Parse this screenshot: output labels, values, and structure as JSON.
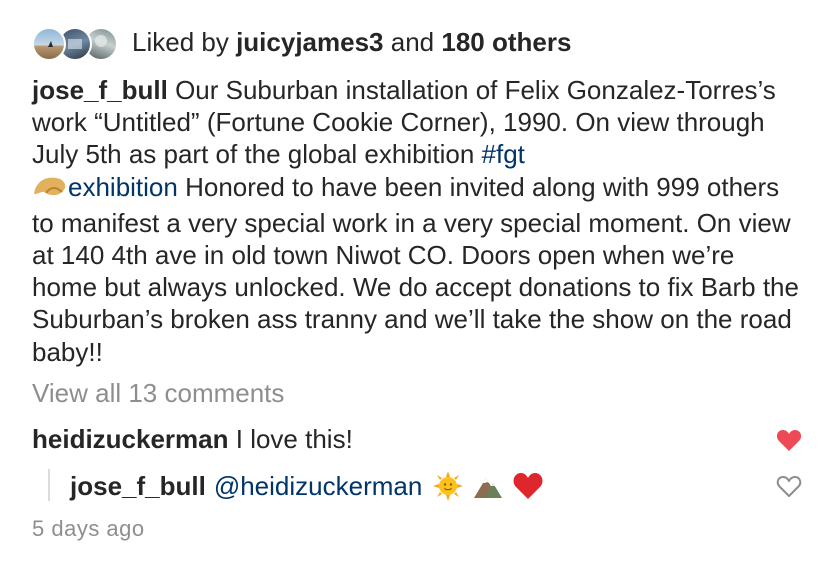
{
  "likes": {
    "prefix": "Liked by",
    "user": "juicyjames3",
    "connector": "and",
    "others": "180 others"
  },
  "post": {
    "username": "jose_f_bull",
    "caption_part1": "Our Suburban installation of Felix Gonzalez-Torres’s work “Untitled” (Fortune Cookie Corner), 1990. On view through July 5th as part of the global exhibition ",
    "hashtag": "#fgt",
    "cookie_icon": "fortune-cookie-emoji",
    "hashtag_cont": "exhibition",
    "caption_part2": " Honored to have been invited along with 999 others to manifest a very special work in a very special moment. On view at 140 4th ave in old town Niwot CO. Doors open when we’re home but always unlocked. We do accept donations to fix Barb the Suburban’s broken ass tranny and we’ll take the show on the road baby!!"
  },
  "view_all": "View all 13 comments",
  "comment": {
    "username": "heidizuckerman",
    "text": "I love this!",
    "like_icon": "heart-filled-icon",
    "like_color": "#ed4956"
  },
  "reply": {
    "username": "jose_f_bull",
    "mention": "@heidizuckerman",
    "emojis": [
      "sun-face-emoji",
      "mountain-emoji",
      "red-heart-emoji"
    ],
    "like_icon": "heart-outline-icon"
  },
  "timestamp": "5 days ago",
  "colors": {
    "text": "#262626",
    "link": "#003569",
    "muted": "#8e8e8e",
    "heart": "#ed4956"
  }
}
